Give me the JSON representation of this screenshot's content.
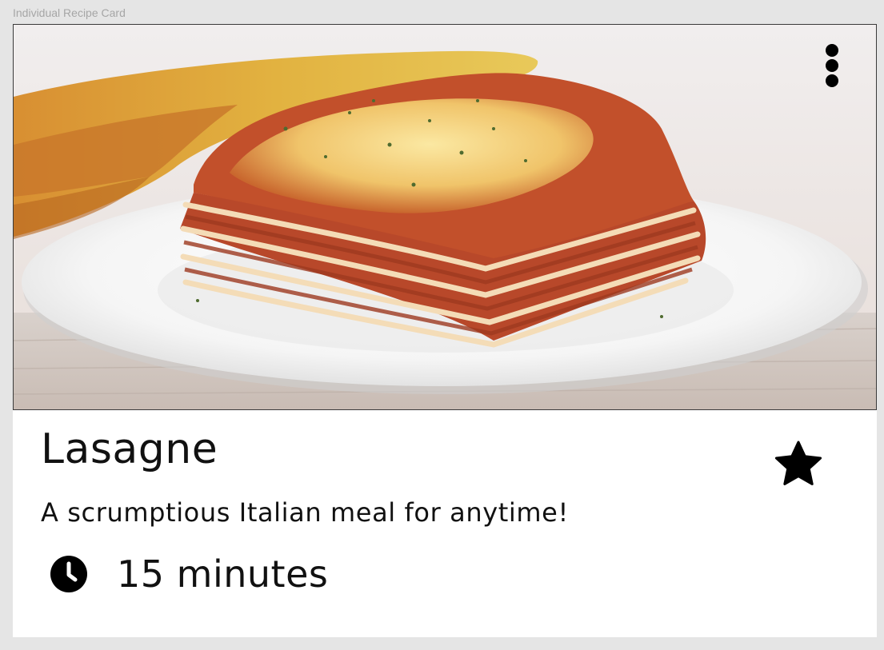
{
  "frame": {
    "label": "Individual Recipe Card"
  },
  "recipe": {
    "title": "Lasagne",
    "description": "A scrumptious Italian meal for anytime!",
    "time": "15 minutes",
    "favorited": true
  },
  "icons": {
    "more": "more-vertical-icon",
    "favorite": "star-icon",
    "time": "clock-icon"
  },
  "colors": {
    "text": "#111111",
    "icon": "#000000",
    "canvas": "#e5e5e5",
    "card": "#ffffff"
  }
}
